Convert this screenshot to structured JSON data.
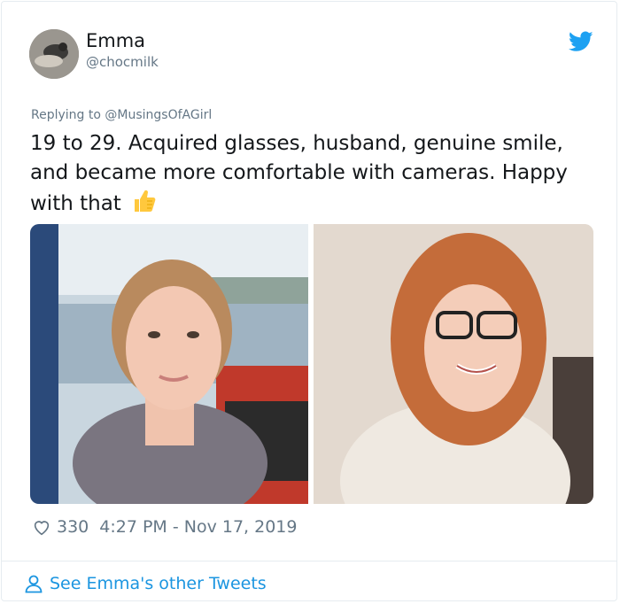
{
  "tweet": {
    "author_name": "Emma",
    "author_handle": "@chocmilk",
    "reply_prefix": "Replying to ",
    "reply_mention": "@MusingsOfAGirl",
    "text": "19 to 29. Acquired glasses, husband, genuine smile, and became more comfortable with cameras. Happy with that",
    "emoji_icon": "thumbs-up-icon",
    "likes": "330",
    "timestamp": "4:27 PM - Nov 17, 2019"
  },
  "footer": {
    "link_label": "See Emma's other Tweets"
  },
  "colors": {
    "twitter_blue": "#1da1f2",
    "link_blue": "#1b95e0",
    "secondary_text": "#657786",
    "border": "#e6ecf0"
  },
  "icons": {
    "brand": "twitter-bird-icon",
    "like": "heart-icon",
    "profile": "person-icon"
  }
}
